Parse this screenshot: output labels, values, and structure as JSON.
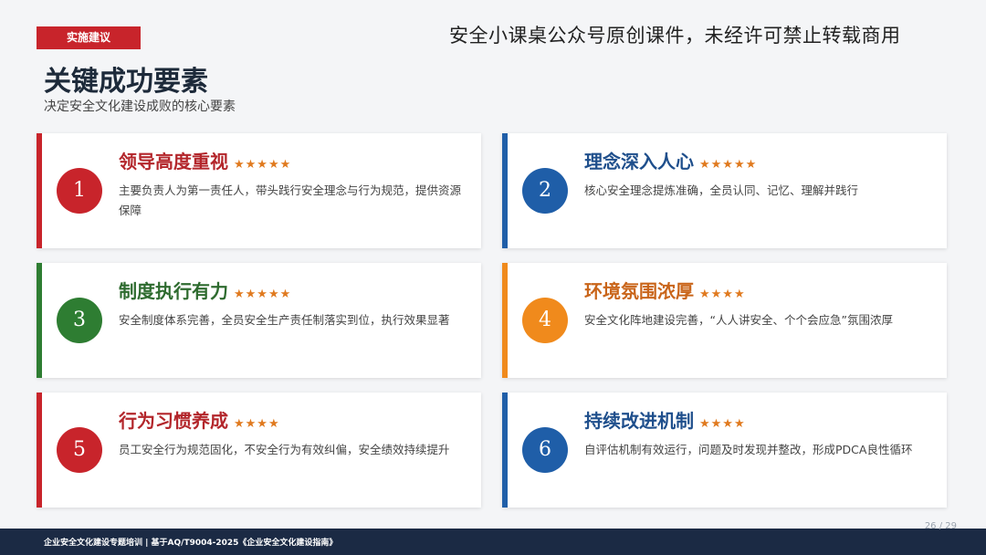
{
  "header": {
    "tag": "实施建议",
    "watermark": "安全小课桌公众号原创课件，未经许可禁止转载商用",
    "title": "关键成功要素",
    "subtitle": "决定安全文化建设成败的核心要素"
  },
  "cards": [
    {
      "num": "1",
      "title": "领导高度重视",
      "stars": "★★★★★",
      "desc": "主要负责人为第一责任人，带头践行安全理念与行为规范，提供资源保障",
      "accent": "#c8242b",
      "title_color": "#b3262b"
    },
    {
      "num": "2",
      "title": "理念深入人心",
      "stars": "★★★★★",
      "desc": "核心安全理念提炼准确，全员认同、记忆、理解并践行",
      "accent": "#1f5ea8",
      "title_color": "#1f4f8c"
    },
    {
      "num": "3",
      "title": "制度执行有力",
      "stars": "★★★★★",
      "desc": "安全制度体系完善，全员安全生产责任制落实到位，执行效果显著",
      "accent": "#2e7d32",
      "title_color": "#2e6b2f"
    },
    {
      "num": "4",
      "title": "环境氛围浓厚",
      "stars": "★★★★",
      "desc": "安全文化阵地建设完善，“人人讲安全、个个会应急”氛围浓厚",
      "accent": "#f08a1c",
      "title_color": "#c9651a"
    },
    {
      "num": "5",
      "title": "行为习惯养成",
      "stars": "★★★★",
      "desc": "员工安全行为规范固化，不安全行为有效纠偏，安全绩效持续提升",
      "accent": "#c8242b",
      "title_color": "#b3262b"
    },
    {
      "num": "6",
      "title": "持续改进机制",
      "stars": "★★★★",
      "desc": "自评估机制有效运行，问题及时发现并整改，形成PDCA良性循环",
      "accent": "#1f5ea8",
      "title_color": "#1f4f8c"
    }
  ],
  "footer": {
    "text": "企业安全文化建设专题培训 | 基于AQ/T9004-2025《企业安全文化建设指南》",
    "page": "26 / 29"
  }
}
